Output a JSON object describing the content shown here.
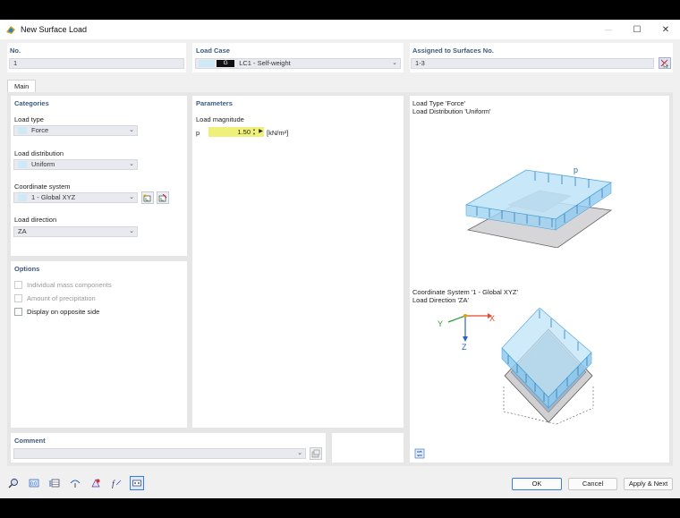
{
  "window": {
    "title": "New Surface Load",
    "minimize_glyph": "—",
    "maximize_glyph": "☐",
    "close_glyph": "✕"
  },
  "header": {
    "no_label": "No.",
    "no_value": "1",
    "load_case_label": "Load Case",
    "load_case_badge": "G",
    "load_case_value": "LC1 - Self-weight",
    "assigned_label": "Assigned to Surfaces No.",
    "assigned_value": "1-3"
  },
  "tabs": [
    {
      "label": "Main"
    }
  ],
  "categories": {
    "title": "Categories",
    "load_type_label": "Load type",
    "load_type_value": "Force",
    "load_distribution_label": "Load distribution",
    "load_distribution_value": "Uniform",
    "coordinate_system_label": "Coordinate system",
    "coordinate_system_value": "1 - Global XYZ",
    "load_direction_label": "Load direction",
    "load_direction_value": "ZA"
  },
  "options": {
    "title": "Options",
    "items": [
      {
        "label": "Individual mass components",
        "enabled": false,
        "checked": false
      },
      {
        "label": "Amount of precipitation",
        "enabled": false,
        "checked": false
      },
      {
        "label": "Display on opposite side",
        "enabled": true,
        "checked": false
      }
    ]
  },
  "parameters": {
    "title": "Parameters",
    "load_magnitude_label": "Load magnitude",
    "symbol": "p",
    "value": "1.50",
    "unit": "[kN/m²]"
  },
  "preview": {
    "top_line1": "Load Type 'Force'",
    "top_line2": "Load Distribution 'Uniform'",
    "bottom_line1": "Coordinate System '1 - Global XYZ'",
    "bottom_line2": "Load Direction 'ZA'",
    "p_label": "p",
    "axis_x": "X",
    "axis_y": "Y",
    "axis_z": "Z"
  },
  "comment": {
    "label": "Comment",
    "value": ""
  },
  "buttons": {
    "ok": "OK",
    "cancel": "Cancel",
    "apply_next": "Apply & Next"
  },
  "colors": {
    "accent": "#3c7bd6",
    "heading": "#3d5a80",
    "load_blue": "#4aa8e0",
    "input_yellow": "#eef07a",
    "axis_x": "#e8482c",
    "axis_y": "#2e9b3a",
    "axis_z": "#2a62c0"
  }
}
